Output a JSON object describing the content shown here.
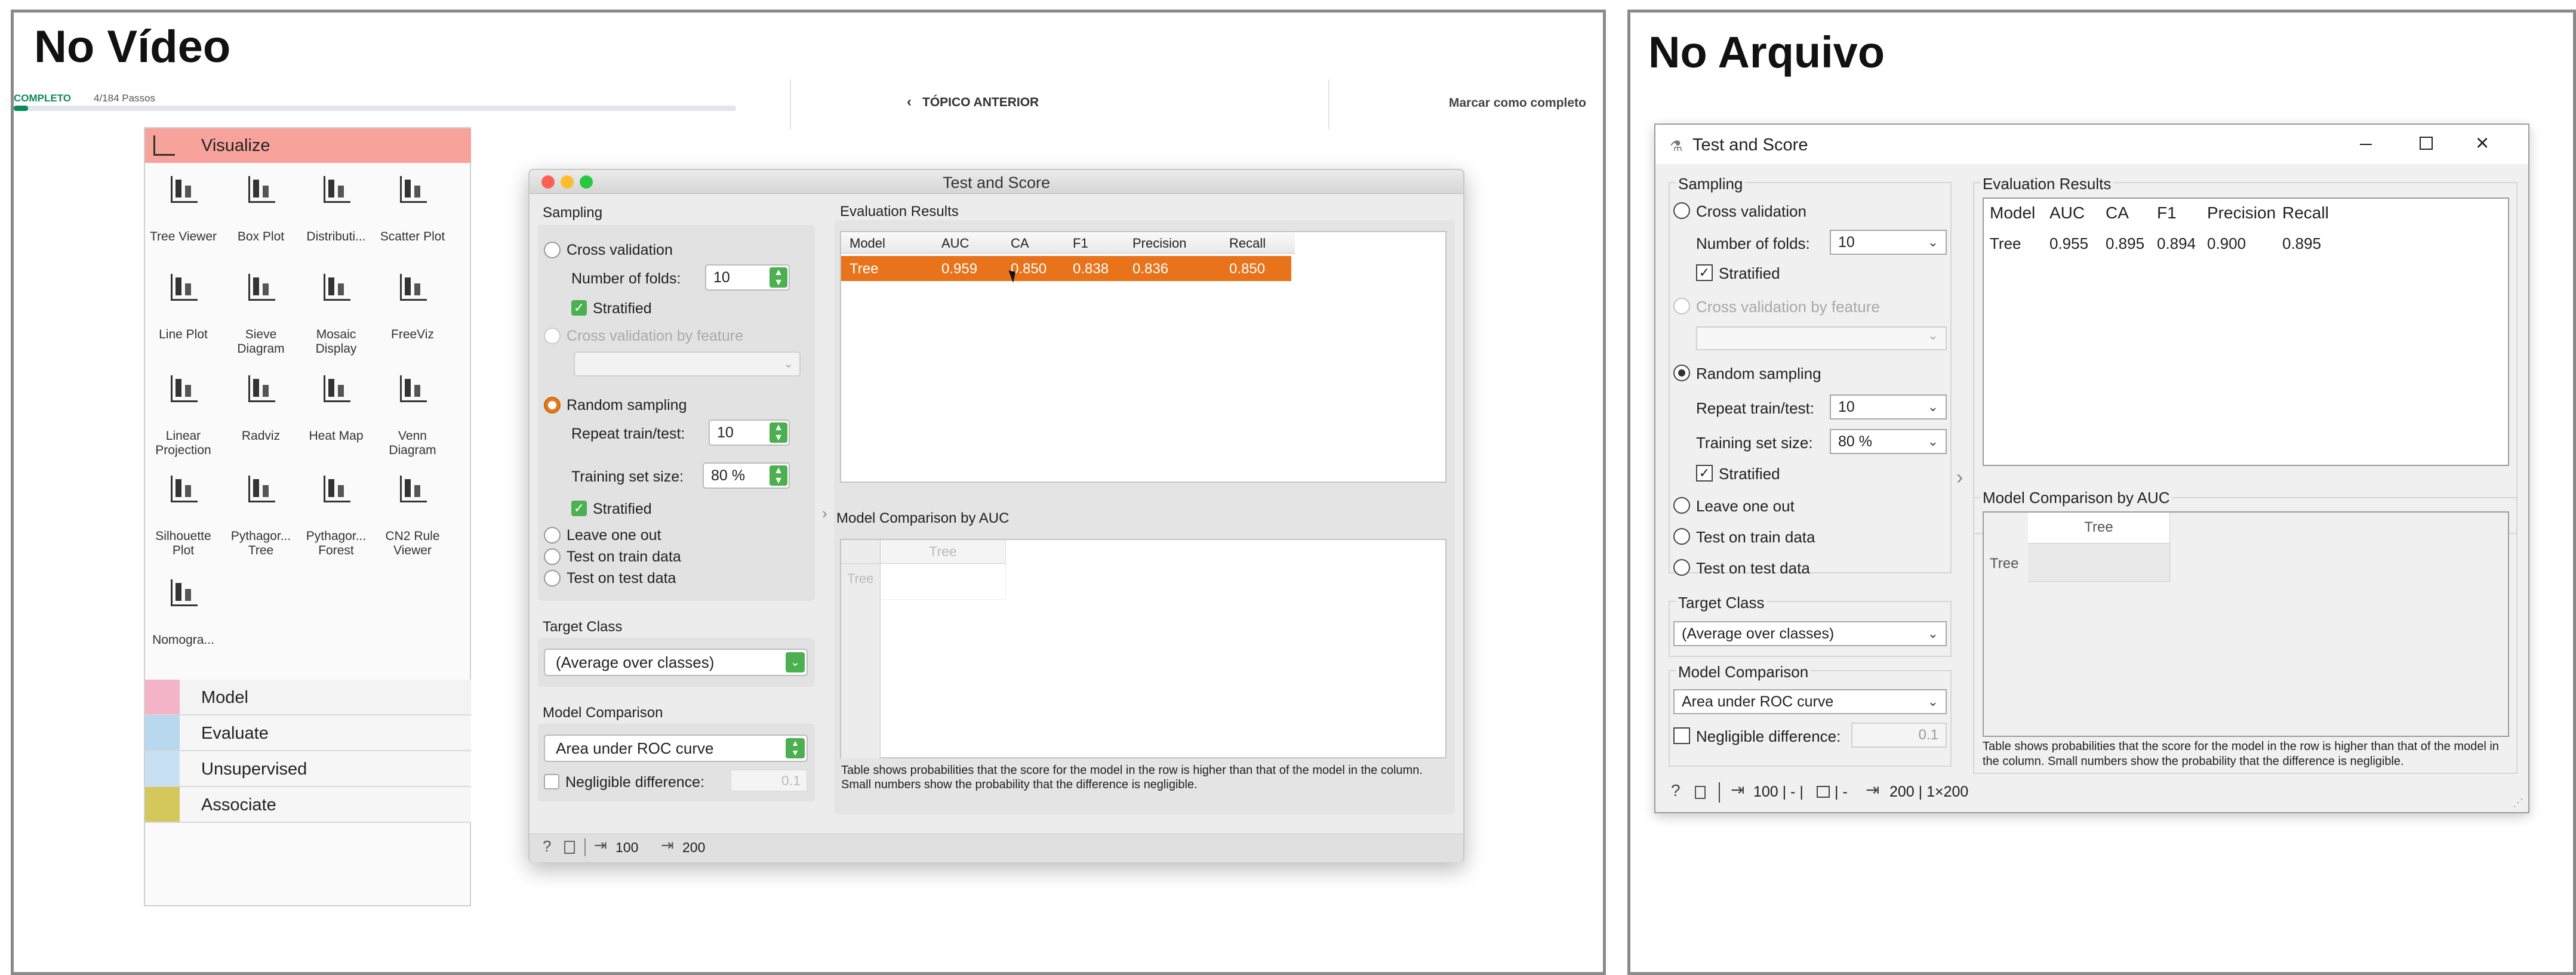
{
  "left_panel": {
    "title": "No Vídeo",
    "course_bar": {
      "status": "COMPLETO",
      "steps": "4/184 Passos",
      "prev_topic": "TÓPICO ANTERIOR",
      "mark_complete": "Marcar como completo",
      "progress": 0.02
    },
    "toolbox": {
      "active_category": "Visualize",
      "widgets": [
        "Tree Viewer",
        "Box Plot",
        "Distributi...",
        "Scatter Plot",
        "Line Plot",
        "Sieve Diagram",
        "Mosaic Display",
        "FreeViz",
        "Linear Projection",
        "Radviz",
        "Heat Map",
        "Venn Diagram",
        "Silhouette Plot",
        "Pythagor... Tree",
        "Pythagor... Forest",
        "CN2 Rule Viewer",
        "Nomogra..."
      ],
      "categories": [
        "Model",
        "Evaluate",
        "Unsupervised",
        "Associate"
      ]
    },
    "window": {
      "title": "Test and Score",
      "sampling": {
        "title": "Sampling",
        "cross_validation": "Cross validation",
        "folds_label": "Number of folds:",
        "folds_value": "10",
        "stratified": "Stratified",
        "cv_by_feature": "Cross validation by feature",
        "random_sampling": "Random sampling",
        "repeat_label": "Repeat train/test:",
        "repeat_value": "10",
        "train_size_label": "Training set size:",
        "train_size_value": "80 %",
        "stratified2": "Stratified",
        "leave_one_out": "Leave one out",
        "test_on_train": "Test on train data",
        "test_on_test": "Test on test data"
      },
      "target_class": {
        "title": "Target Class",
        "value": "(Average over classes)"
      },
      "model_comparison": {
        "title": "Model Comparison",
        "value": "Area under ROC curve",
        "negligible_label": "Negligible difference:",
        "negligible_value": "0.1"
      },
      "evaluation": {
        "title": "Evaluation Results",
        "headers": [
          "Model",
          "AUC",
          "CA",
          "F1",
          "Precision",
          "Recall"
        ],
        "row": [
          "Tree",
          "0.959",
          "0.850",
          "0.838",
          "0.836",
          "0.850"
        ]
      },
      "comparison": {
        "title": "Model Comparison by AUC",
        "col": "Tree",
        "row": "Tree",
        "note": "Table shows probabilities that the score for the model in the row is higher than that of the model in the column. Small numbers show the probability that the difference is negligible."
      },
      "status": {
        "in": "100",
        "out": "200"
      }
    }
  },
  "right_panel": {
    "title": "No Arquivo",
    "window": {
      "title": "Test and Score",
      "sampling": {
        "title": "Sampling",
        "cross_validation": "Cross validation",
        "folds_label": "Number of folds:",
        "folds_value": "10",
        "stratified": "Stratified",
        "cv_by_feature": "Cross validation by feature",
        "random_sampling": "Random sampling",
        "repeat_label": "Repeat train/test:",
        "repeat_value": "10",
        "train_size_label": "Training set size:",
        "train_size_value": "80 %",
        "stratified2": "Stratified",
        "leave_one_out": "Leave one out",
        "test_on_train": "Test on train data",
        "test_on_test": "Test on test data"
      },
      "target_class": {
        "title": "Target Class",
        "value": "(Average over classes)"
      },
      "model_comparison": {
        "title": "Model Comparison",
        "value": "Area under ROC curve",
        "negligible_label": "Negligible difference:",
        "negligible_value": "0.1"
      },
      "evaluation": {
        "title": "Evaluation Results",
        "headers": [
          "Model",
          "AUC",
          "CA",
          "F1",
          "Precision",
          "Recall"
        ],
        "row": [
          "Tree",
          "0.955",
          "0.895",
          "0.894",
          "0.900",
          "0.895"
        ]
      },
      "comparison": {
        "title": "Model Comparison by AUC",
        "col": "Tree",
        "row": "Tree",
        "note": "Table shows probabilities that the score for the model in the row is higher than that of the model in the column. Small numbers show the probability that the difference is negligible."
      },
      "status": {
        "in": "100 | - |",
        "mid": "| -",
        "out": "200 | 1×200"
      }
    }
  },
  "colors": {
    "accent": "#e77817",
    "green": "#4caf50",
    "visualize": "#f7a29a"
  }
}
